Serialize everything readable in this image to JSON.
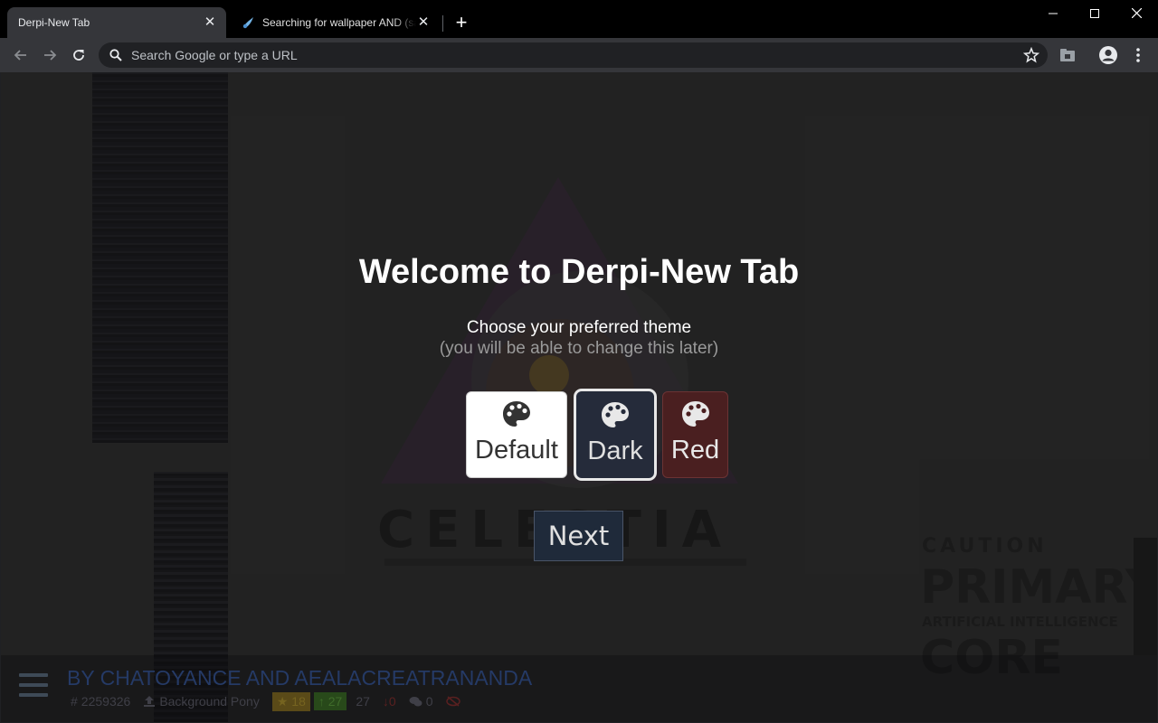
{
  "browser": {
    "tabs": [
      {
        "title": "Derpi-New Tab",
        "active": true
      },
      {
        "title": "Searching for wallpaper AND (safe",
        "active": false
      }
    ],
    "omnibox_placeholder": "Search Google or type a URL"
  },
  "welcome": {
    "title": "Welcome to Derpi-New Tab",
    "subtitle": "Choose your preferred theme",
    "note": "(you will be able to change this later)",
    "themes": [
      {
        "label": "Default",
        "icon": "palette-icon"
      },
      {
        "label": "Dark",
        "icon": "palette-icon",
        "selected": true
      },
      {
        "label": "Red",
        "icon": "palette-icon"
      }
    ],
    "next_label": "Next"
  },
  "image_info": {
    "artist": "BY CHATOYANCE AND AEALACREATRANANDA",
    "id": "2259326",
    "uploader": "Background Pony",
    "faves": "18",
    "upvotes": "27",
    "score": "27",
    "downvotes": "0",
    "comments": "0"
  },
  "colors": {
    "dark_theme": "#252b3a",
    "red_theme": "#4a1f20",
    "tab_bg": "#35363a"
  }
}
